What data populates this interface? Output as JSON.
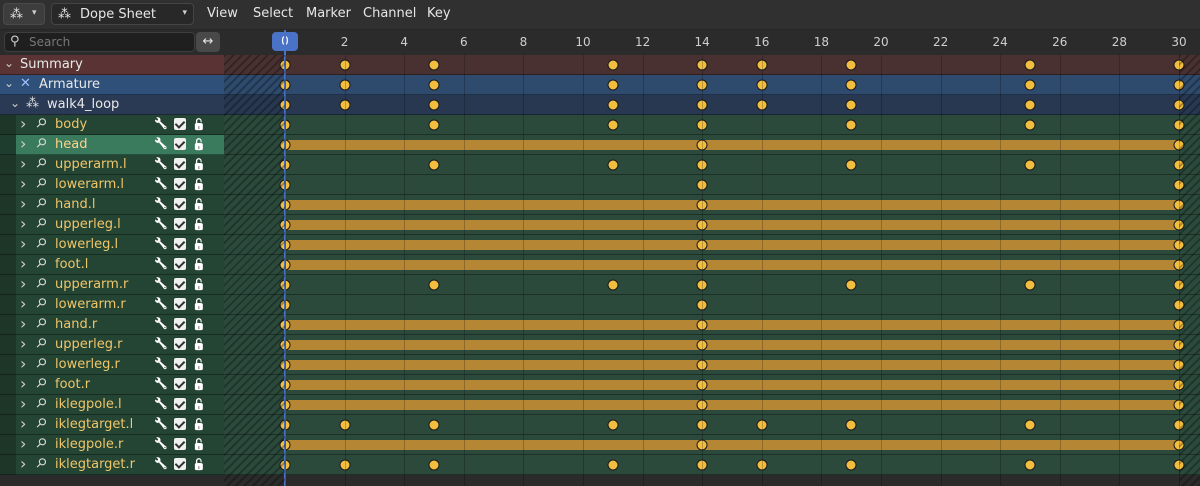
{
  "header": {
    "editor_icon": "dope-sheet-icon",
    "mode_label": "Dope Sheet",
    "menus": [
      "View",
      "Select",
      "Marker",
      "Channel",
      "Key"
    ]
  },
  "search": {
    "placeholder": "Search",
    "value": ""
  },
  "ruler": {
    "labels": [
      "0",
      "2",
      "4",
      "6",
      "8",
      "10",
      "12",
      "14",
      "16",
      "18",
      "20",
      "22",
      "24",
      "26",
      "28",
      "30"
    ],
    "current_frame": "0"
  },
  "colors": {
    "summary_row": "#5a3434",
    "armature_row": "#2f5079",
    "action_row": "#2a3a54",
    "channel_row": "#244434",
    "selected_row": "#3a7a5d",
    "hold_bar": "#b58633",
    "keyframe": "#f2be3f",
    "playhead": "#4a72c6"
  },
  "channels": [
    {
      "label": "Summary",
      "type": "summary",
      "keys": [
        0,
        2,
        5,
        11,
        14,
        16,
        19,
        25,
        30
      ],
      "holds": []
    },
    {
      "label": "Armature",
      "type": "object",
      "keys": [
        0,
        2,
        5,
        11,
        14,
        16,
        19,
        25,
        30
      ],
      "holds": []
    },
    {
      "label": "walk4_loop",
      "type": "action",
      "keys": [
        0,
        2,
        5,
        11,
        14,
        16,
        19,
        25,
        30
      ],
      "holds": []
    },
    {
      "label": "body",
      "type": "bone",
      "keys": [
        0,
        5,
        11,
        14,
        19,
        25,
        30
      ],
      "holds": []
    },
    {
      "label": "head",
      "type": "bone",
      "selected": true,
      "keys": [
        0,
        14,
        30
      ],
      "holds": [
        [
          0,
          14
        ],
        [
          14,
          30
        ]
      ]
    },
    {
      "label": "upperarm.l",
      "type": "bone",
      "keys": [
        0,
        5,
        11,
        14,
        19,
        25,
        30
      ],
      "holds": []
    },
    {
      "label": "lowerarm.l",
      "type": "bone",
      "keys": [
        0,
        14,
        30
      ],
      "holds": []
    },
    {
      "label": "hand.l",
      "type": "bone",
      "keys": [
        0,
        14,
        30
      ],
      "holds": [
        [
          0,
          14
        ],
        [
          14,
          30
        ]
      ]
    },
    {
      "label": "upperleg.l",
      "type": "bone",
      "keys": [
        0,
        14,
        30
      ],
      "holds": [
        [
          0,
          14
        ],
        [
          14,
          30
        ]
      ]
    },
    {
      "label": "lowerleg.l",
      "type": "bone",
      "keys": [
        0,
        14,
        30
      ],
      "holds": [
        [
          0,
          14
        ],
        [
          14,
          30
        ]
      ]
    },
    {
      "label": "foot.l",
      "type": "bone",
      "keys": [
        0,
        14,
        30
      ],
      "holds": [
        [
          0,
          14
        ],
        [
          14,
          30
        ]
      ]
    },
    {
      "label": "upperarm.r",
      "type": "bone",
      "keys": [
        0,
        5,
        11,
        14,
        19,
        25,
        30
      ],
      "holds": []
    },
    {
      "label": "lowerarm.r",
      "type": "bone",
      "keys": [
        0,
        14,
        30
      ],
      "holds": []
    },
    {
      "label": "hand.r",
      "type": "bone",
      "keys": [
        0,
        14,
        30
      ],
      "holds": [
        [
          0,
          14
        ],
        [
          14,
          30
        ]
      ]
    },
    {
      "label": "upperleg.r",
      "type": "bone",
      "keys": [
        0,
        14,
        30
      ],
      "holds": [
        [
          0,
          14
        ],
        [
          14,
          30
        ]
      ]
    },
    {
      "label": "lowerleg.r",
      "type": "bone",
      "keys": [
        0,
        14,
        30
      ],
      "holds": [
        [
          0,
          14
        ],
        [
          14,
          30
        ]
      ]
    },
    {
      "label": "foot.r",
      "type": "bone",
      "keys": [
        0,
        14,
        30
      ],
      "holds": [
        [
          0,
          14
        ],
        [
          14,
          30
        ]
      ]
    },
    {
      "label": "iklegpole.l",
      "type": "bone",
      "keys": [
        0,
        14,
        30
      ],
      "holds": [
        [
          0,
          14
        ],
        [
          14,
          30
        ]
      ]
    },
    {
      "label": "iklegtarget.l",
      "type": "bone",
      "keys": [
        0,
        2,
        5,
        11,
        14,
        16,
        19,
        25,
        30
      ],
      "holds": []
    },
    {
      "label": "iklegpole.r",
      "type": "bone",
      "keys": [
        0,
        14,
        30
      ],
      "holds": [
        [
          0,
          14
        ],
        [
          14,
          30
        ]
      ]
    },
    {
      "label": "iklegtarget.r",
      "type": "bone",
      "keys": [
        0,
        2,
        5,
        11,
        14,
        16,
        19,
        25,
        30
      ],
      "holds": []
    }
  ]
}
